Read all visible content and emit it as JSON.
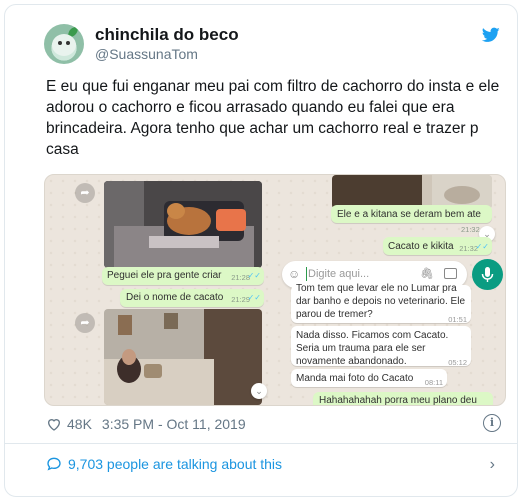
{
  "user": {
    "display_name": "chinchila do beco",
    "handle": "@SuassunaTom",
    "avatar_icon": "chinchilla-avatar"
  },
  "brand": {
    "icon": "twitter-bird-icon",
    "color": "#1da1f2"
  },
  "tweet": {
    "text": "E eu que fui enganar meu pai com filtro de cachorro do insta e ele adorou o cachorro e ficou arrasado quando eu falei que era brincadeira. Agora tenho que achar um cachorro real e trazer p casa"
  },
  "chat": {
    "messages_left_column": [
      {
        "text": "Peguei ele pra gente criar",
        "time": "21:28"
      },
      {
        "text": "Dei o nome de cacato",
        "time": "21:29"
      }
    ],
    "messages_right_column": [
      {
        "text": "Ele e a kitana se deram bem ate",
        "time": "21:32",
        "from": "me"
      },
      {
        "text": "Cacato e kikita",
        "time": "21:32",
        "from": "me"
      },
      {
        "text": "Tom tem que levar ele no Lumar pra dar banho e depois no veterinario. Ele parou de tremer?",
        "time": "01:51",
        "from": "other"
      },
      {
        "text": "Nada disso. Ficamos com Cacato. Seria um trauma para ele ser novamente abandonado.",
        "time": "05:12",
        "from": "other"
      },
      {
        "text": "Manda mai foto do Cacato",
        "time": "08:11",
        "from": "other"
      },
      {
        "text": "Hahahahahah porra meu plano deu",
        "time": "",
        "from": "me"
      }
    ],
    "input_placeholder": "Digite aqui..."
  },
  "stats": {
    "likes": "48K",
    "timestamp": "3:35 PM - Oct 11, 2019",
    "talking": "9,703 people are talking about this"
  },
  "colors": {
    "bubble_out": "#dcf8c6",
    "link": "#1b95e0",
    "mic": "#0a9c82"
  }
}
